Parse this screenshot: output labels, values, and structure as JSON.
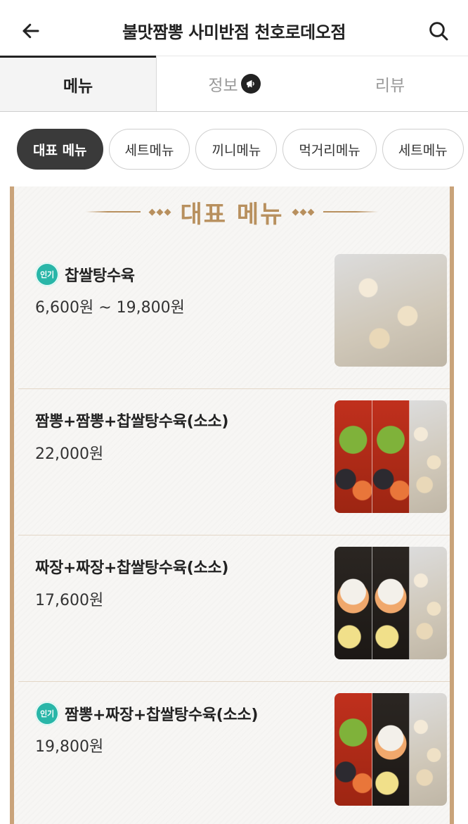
{
  "header": {
    "title": "불맛짬뽕 사미반점 천호로데오점"
  },
  "tabs": [
    {
      "label": "메뉴",
      "active": true
    },
    {
      "label": "정보",
      "icon": "megaphone-icon"
    },
    {
      "label": "리뷰"
    }
  ],
  "chips": [
    {
      "label": "대표 메뉴",
      "active": true
    },
    {
      "label": "세트메뉴"
    },
    {
      "label": "끼니메뉴"
    },
    {
      "label": "먹거리메뉴"
    },
    {
      "label": "세트메뉴"
    }
  ],
  "board": {
    "title": "대표 메뉴"
  },
  "items": [
    {
      "badge": "인기",
      "name": "찹쌀탕수육",
      "price": "6,600원 ~ 19,800원"
    },
    {
      "name": "짬뽕+짬뽕+찹쌀탕수육(소소)",
      "price": "22,000원"
    },
    {
      "name": "짜장+짜장+찹쌀탕수육(소소)",
      "price": "17,600원"
    },
    {
      "badge": "인기",
      "name": "짬뽕+짜장+찹쌀탕수육(소소)",
      "price": "19,800원"
    }
  ],
  "colors": {
    "accent_gold": "#b8905e",
    "badge_teal": "#29b6a8",
    "chip_active": "#3a3a3a"
  }
}
